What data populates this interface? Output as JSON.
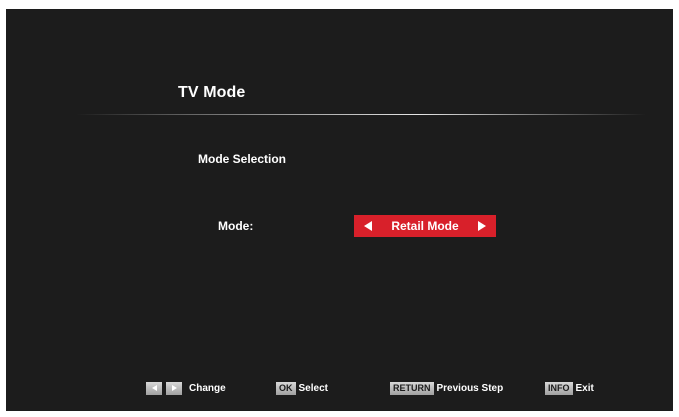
{
  "header": {
    "title": "TV Mode"
  },
  "section": {
    "title": "Mode Selection"
  },
  "mode_setting": {
    "label": "Mode:",
    "value": "Retail Mode",
    "accent_color": "#d8202a"
  },
  "hints": [
    {
      "label": "Change",
      "keys": [
        "left-arrow-icon",
        "right-arrow-icon"
      ]
    },
    {
      "key": "OK",
      "label": "Select"
    },
    {
      "key": "RETURN",
      "label": "Previous Step"
    },
    {
      "key": "INFO",
      "label": "Exit"
    }
  ]
}
